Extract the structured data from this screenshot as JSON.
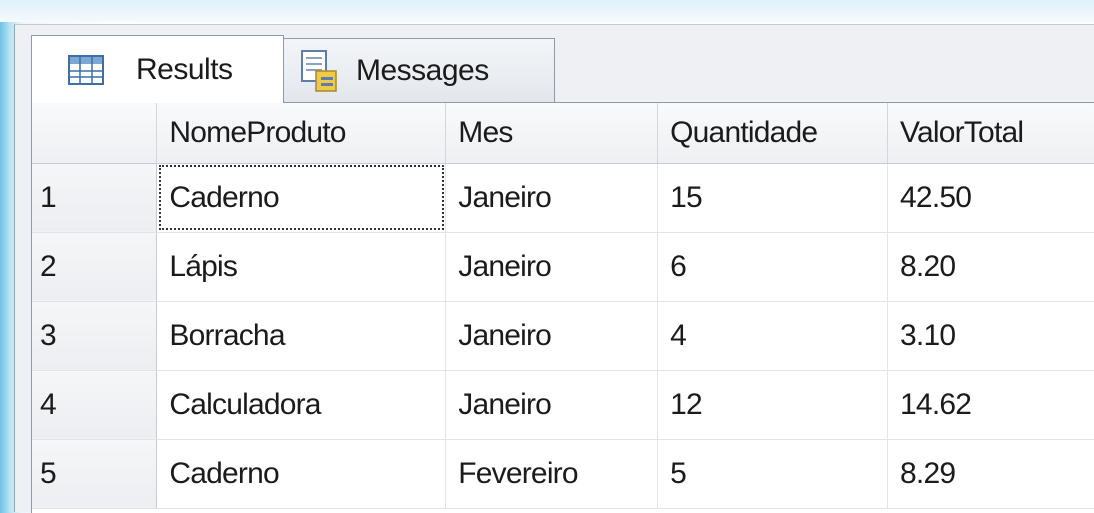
{
  "tabs": {
    "results": {
      "label": "Results",
      "icon": "results-grid-icon"
    },
    "messages": {
      "label": "Messages",
      "icon": "messages-icon"
    }
  },
  "grid": {
    "columns": [
      "NomeProduto",
      "Mes",
      "Quantidade",
      "ValorTotal"
    ],
    "rows": [
      {
        "num": "1",
        "cells": [
          "Caderno",
          "Janeiro",
          "15",
          "42.50"
        ]
      },
      {
        "num": "2",
        "cells": [
          "Lápis",
          "Janeiro",
          "6",
          "8.20"
        ]
      },
      {
        "num": "3",
        "cells": [
          "Borracha",
          "Janeiro",
          "4",
          "3.10"
        ]
      },
      {
        "num": "4",
        "cells": [
          "Calculadora",
          "Janeiro",
          "12",
          "14.62"
        ]
      },
      {
        "num": "5",
        "cells": [
          "Caderno",
          "Fevereiro",
          "5",
          "8.29"
        ]
      }
    ],
    "selected_cell": {
      "row": 1,
      "column": "NomeProduto"
    }
  }
}
